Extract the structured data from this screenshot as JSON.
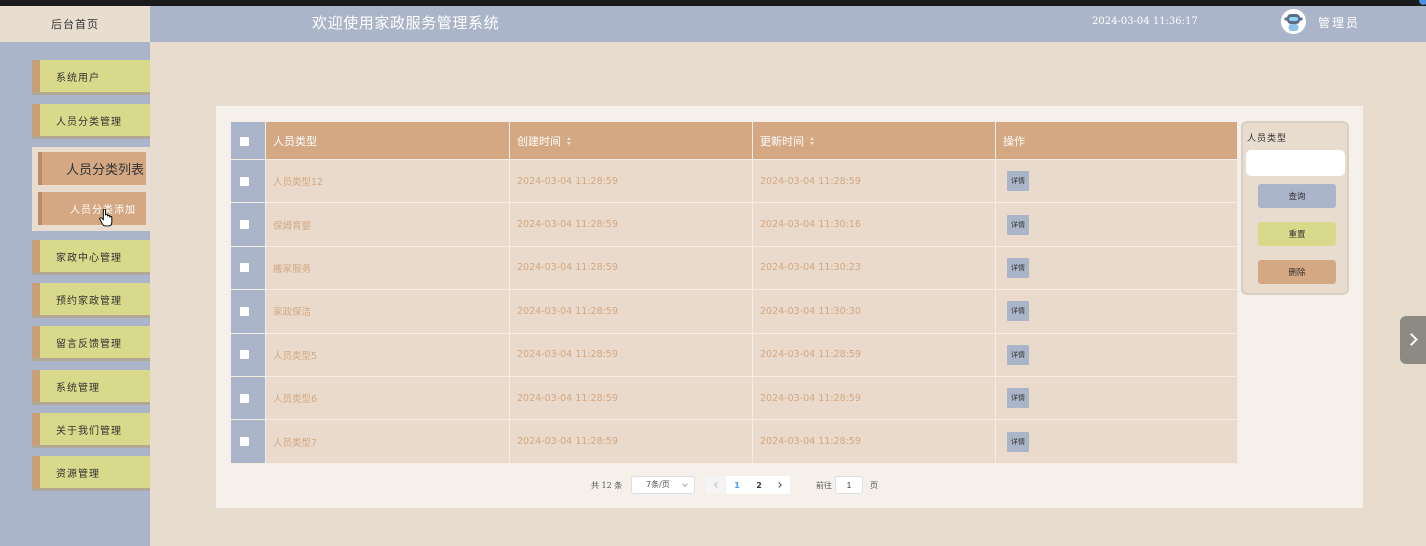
{
  "header": {
    "home_label": "后台首页",
    "title": "欢迎使用家政服务管理系统",
    "datetime": "2024-03-04 11:36:17",
    "user_label": "管理员"
  },
  "sidebar": {
    "items": [
      {
        "label": "系统用户"
      },
      {
        "label": "人员分类管理",
        "expanded": true
      },
      {
        "label": "家政中心管理"
      },
      {
        "label": "预约家政管理"
      },
      {
        "label": "留言反馈管理"
      },
      {
        "label": "系统管理"
      },
      {
        "label": "关于我们管理"
      },
      {
        "label": "资源管理"
      }
    ],
    "submenu": [
      {
        "label": "人员分类列表"
      },
      {
        "label": "人员分类添加",
        "hovered": true
      }
    ]
  },
  "table": {
    "columns": [
      "人员类型",
      "创建时间",
      "更新时间",
      "操作"
    ],
    "sortable": [
      false,
      true,
      true,
      false
    ],
    "action_label": "详情",
    "rows": [
      {
        "type": "人员类型12",
        "created": "2024-03-04 11:28:59",
        "updated": "2024-03-04 11:28:59"
      },
      {
        "type": "保姆育婴",
        "created": "2024-03-04 11:28:59",
        "updated": "2024-03-04 11:30:16"
      },
      {
        "type": "搬家服务",
        "created": "2024-03-04 11:28:59",
        "updated": "2024-03-04 11:30:23"
      },
      {
        "type": "家政保洁",
        "created": "2024-03-04 11:28:59",
        "updated": "2024-03-04 11:30:30"
      },
      {
        "type": "人员类型5",
        "created": "2024-03-04 11:28:59",
        "updated": "2024-03-04 11:28:59"
      },
      {
        "type": "人员类型6",
        "created": "2024-03-04 11:28:59",
        "updated": "2024-03-04 11:28:59"
      },
      {
        "type": "人员类型7",
        "created": "2024-03-04 11:28:59",
        "updated": "2024-03-04 11:28:59"
      }
    ]
  },
  "search": {
    "label": "人员类型",
    "value": "",
    "query_label": "查询",
    "reset_label": "重置",
    "delete_label": "删除"
  },
  "pagination": {
    "total_text": "共 12 条",
    "page_size": "7条/页",
    "pages": [
      "1",
      "2"
    ],
    "current_page": "1",
    "goto_label": "前往",
    "goto_value": "1",
    "goto_suffix": "页"
  },
  "colors": {
    "header_bg": "#abb5c9",
    "main_bg": "#e8dccf",
    "menu_item": "#d9d98b",
    "accent_tan": "#d4a882",
    "row_bg": "#e9dacb",
    "page_active": "#409eff"
  },
  "icons": [
    "robot-avatar-icon",
    "sort-icon",
    "chevron-down-icon",
    "chevron-left-icon",
    "chevron-right-icon",
    "pointer-cursor-icon"
  ]
}
